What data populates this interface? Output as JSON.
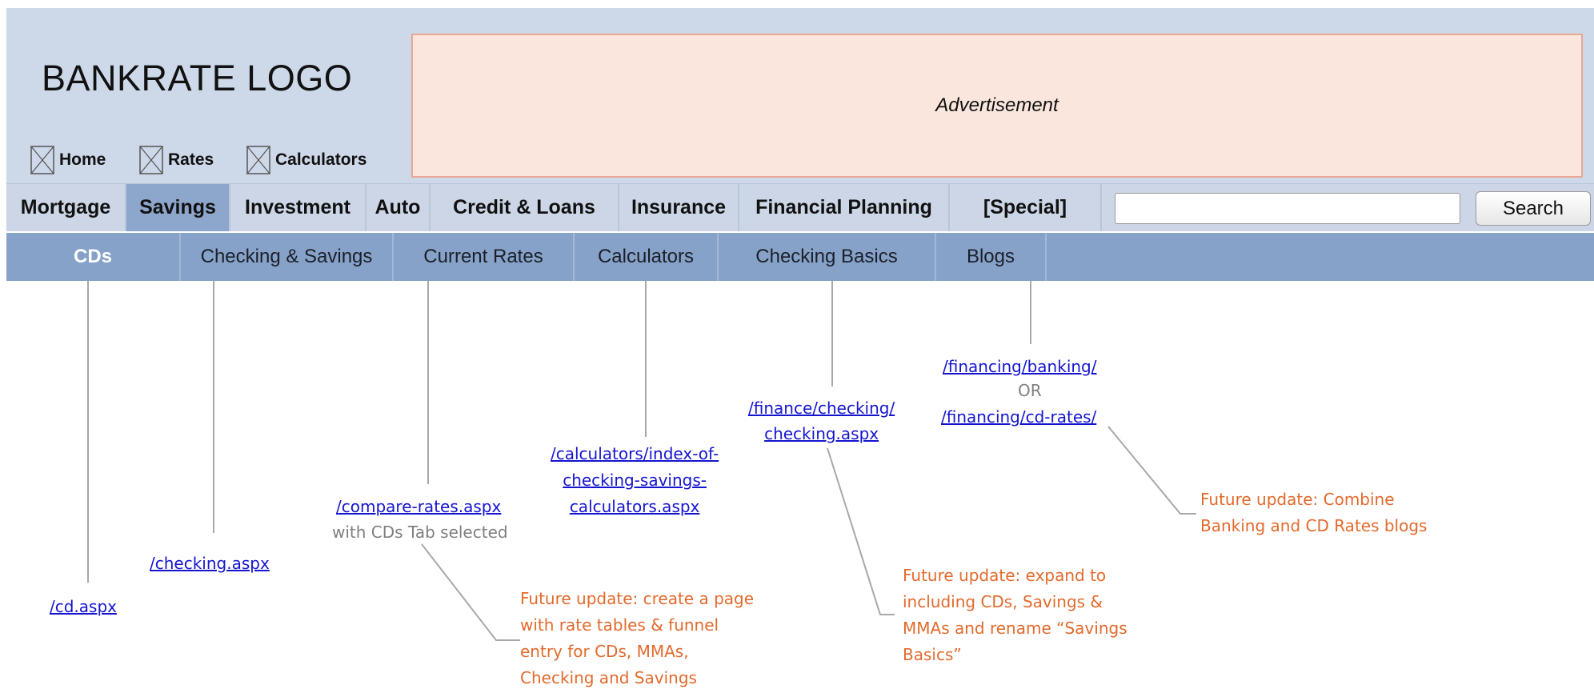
{
  "header": {
    "logo_text": "BANKRATE LOGO",
    "advertisement_label": "Advertisement",
    "top_links": [
      {
        "label": "Home",
        "icon": "broken-image-icon"
      },
      {
        "label": "Rates",
        "icon": "broken-image-icon"
      },
      {
        "label": "Calculators",
        "icon": "broken-image-icon"
      }
    ]
  },
  "main_nav": {
    "tabs": [
      {
        "label": "Mortgage"
      },
      {
        "label": "Savings",
        "active": true
      },
      {
        "label": "Investment"
      },
      {
        "label": "Auto"
      },
      {
        "label": "Credit & Loans"
      },
      {
        "label": "Insurance"
      },
      {
        "label": "Financial Planning"
      },
      {
        "label": "[Special]"
      }
    ],
    "search": {
      "value": "",
      "button_label": "Search"
    }
  },
  "sub_nav": {
    "tabs": [
      {
        "label": "CDs",
        "active": true
      },
      {
        "label": "Checking & Savings"
      },
      {
        "label": "Current Rates"
      },
      {
        "label": "Calculators"
      },
      {
        "label": "Checking Basics"
      },
      {
        "label": "Blogs"
      }
    ]
  },
  "annotations": {
    "cds_url": "/cd.aspx",
    "checking_url": "/checking.aspx",
    "current_rates_url": "/compare-rates.aspx",
    "current_rates_note": "with CDs Tab selected",
    "calculators_url_lines": [
      "/calculators/index-of-",
      "checking-savings-",
      "calculators.aspx"
    ],
    "checking_basics_url_lines": [
      "/finance/checking/",
      "checking.aspx"
    ],
    "blogs_url_1": "/financing/banking/",
    "blogs_or": "OR",
    "blogs_url_2": "/financing/cd-rates/",
    "future_current_rates": [
      "Future update: create a page",
      "with rate tables & funnel",
      "entry for CDs, MMAs,",
      "Checking and Savings"
    ],
    "future_checking_basics": [
      "Future update: expand to",
      "including CDs, Savings &",
      "MMAs and rename “Savings",
      "Basics”"
    ],
    "future_blogs": [
      "Future update: Combine",
      "Banking and CD Rates blogs"
    ]
  },
  "colors": {
    "header_bg": "#cdd8e8",
    "ad_bg": "#fae6dd",
    "ad_border": "#e9a794",
    "subnav_bg": "#86a2c8",
    "active_tab_bg": "#8da6cb",
    "link": "#1515d0",
    "future_note": "#e26a2c"
  }
}
